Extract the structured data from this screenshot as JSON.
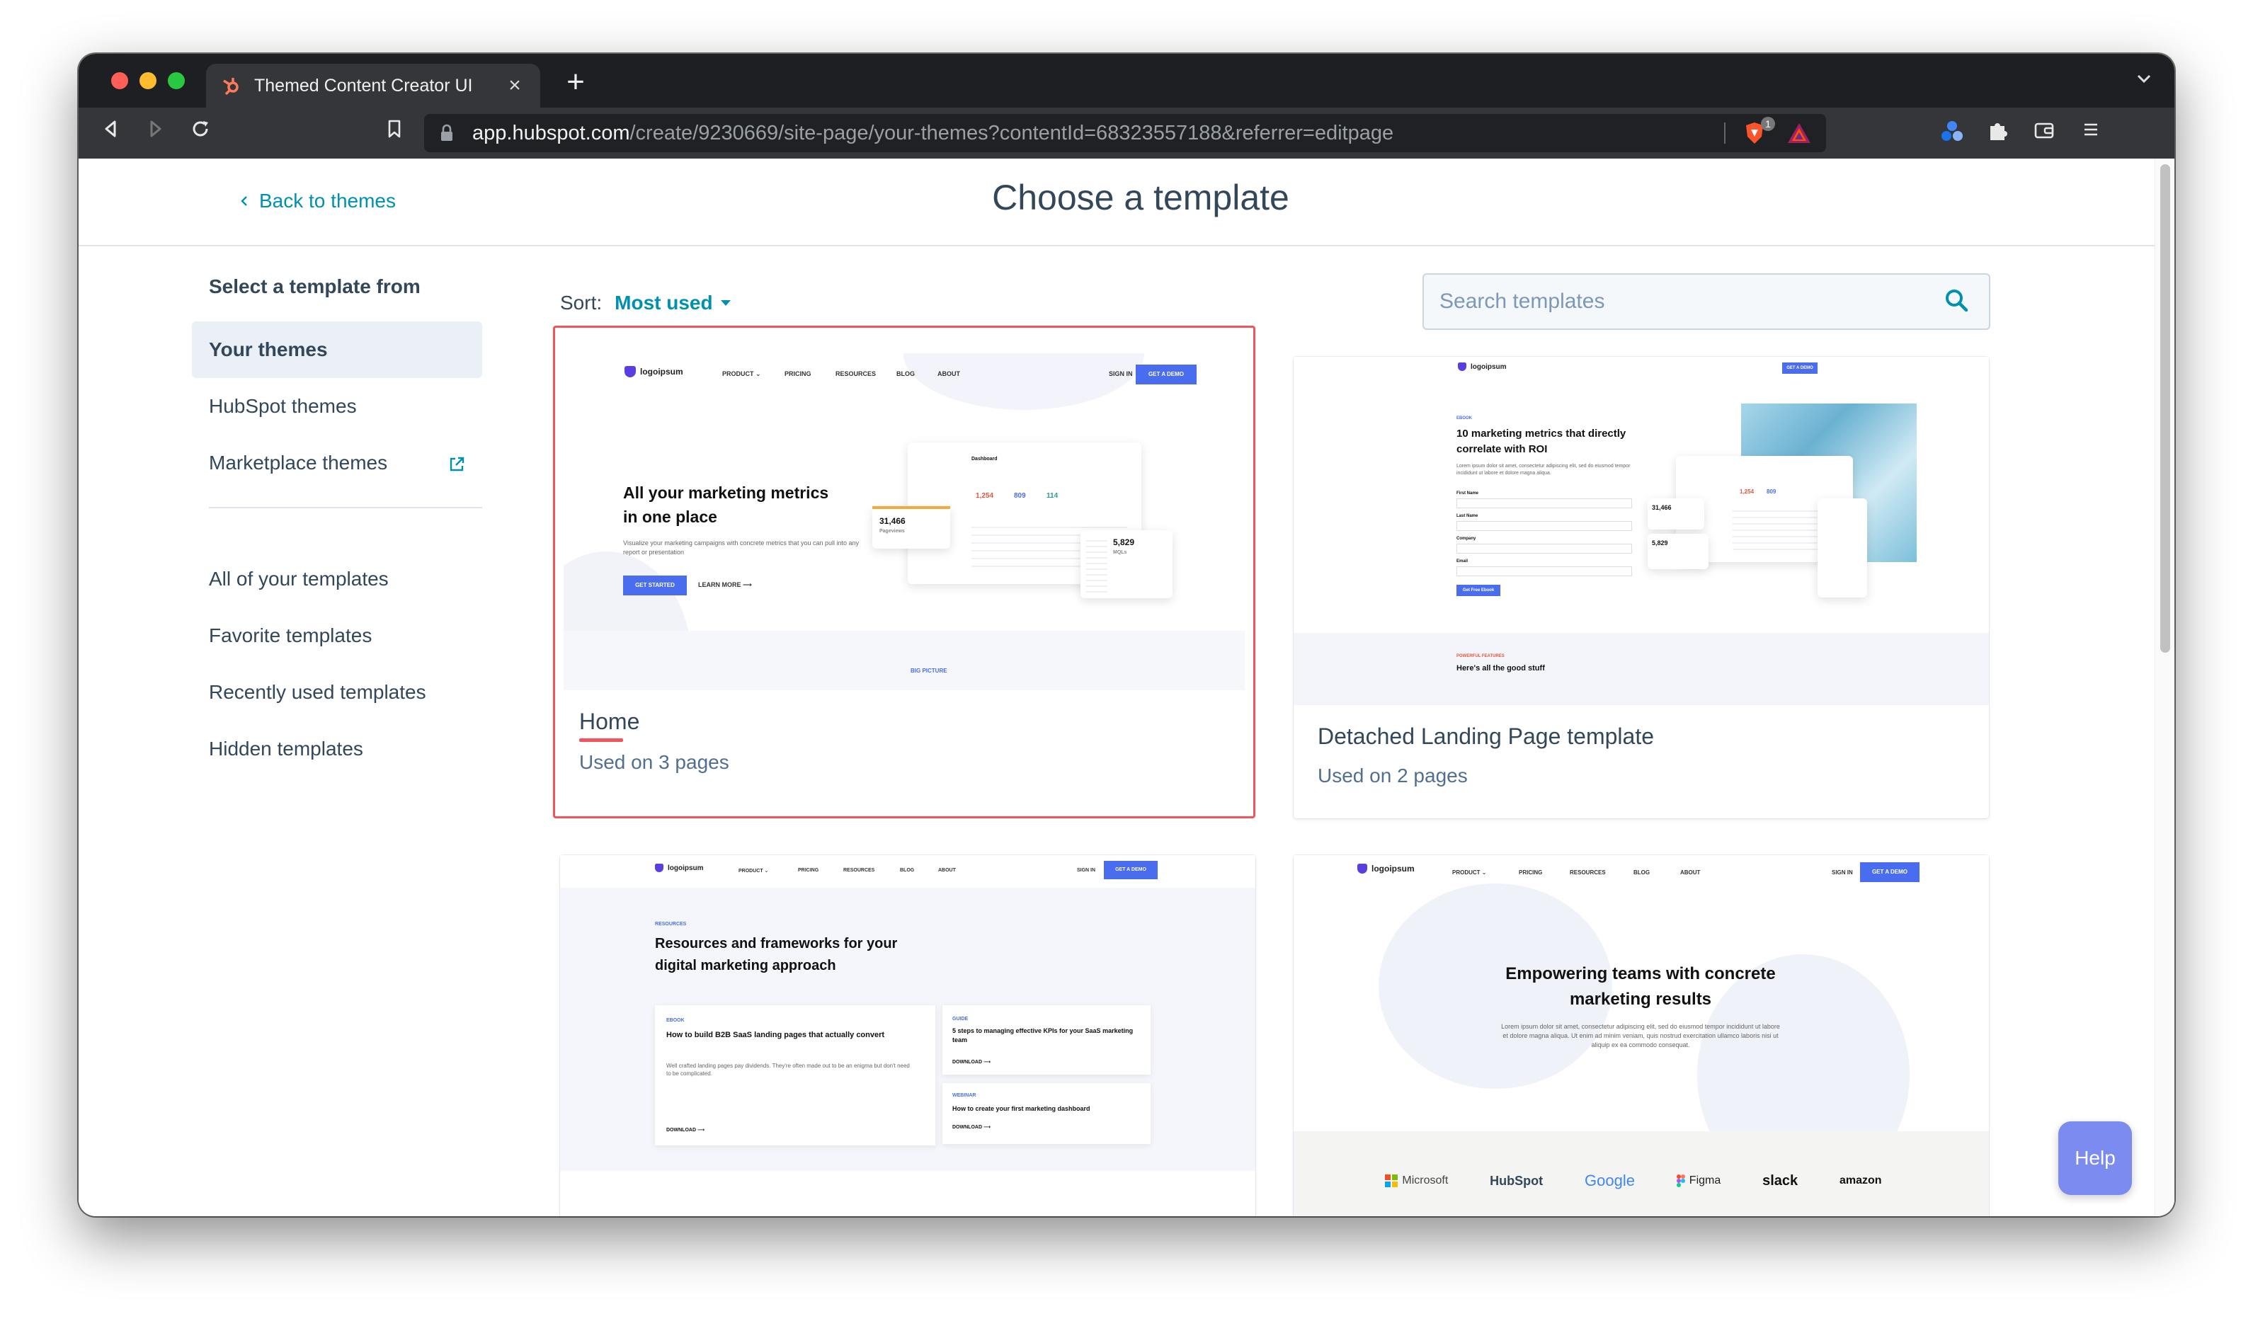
{
  "browser": {
    "tab_title": "Themed Content Creator UI",
    "tab_close": "×",
    "new_tab": "+",
    "url_host": "app.hubspot.com",
    "url_path": "/create/9230669/site-page/your-themes?contentId=68323557188&referrer=editpage",
    "shield_badge": "1"
  },
  "header": {
    "back_label": "Back to themes",
    "title": "Choose a template"
  },
  "sidebar": {
    "heading": "Select a template from",
    "sources": [
      {
        "label": "Your themes",
        "active": true
      },
      {
        "label": "HubSpot themes"
      },
      {
        "label": "Marketplace themes",
        "icon": "external-link-icon"
      }
    ],
    "filters": [
      {
        "label": "All of your templates"
      },
      {
        "label": "Favorite templates"
      },
      {
        "label": "Recently used templates"
      },
      {
        "label": "Hidden templates"
      }
    ]
  },
  "toolbar": {
    "sort_label": "Sort:",
    "sort_value": "Most used",
    "search_placeholder": "Search templates"
  },
  "templates": [
    {
      "name": "Home",
      "usage": "Used on 3 pages",
      "selected": true,
      "preview": {
        "logo": "logoipsum",
        "nav": [
          "PRODUCT ⌄",
          "PRICING",
          "RESOURCES",
          "BLOG",
          "ABOUT"
        ],
        "signin": "SIGN IN",
        "cta": "GET A DEMO",
        "headline": "All your marketing metrics in one place",
        "body": "Visualize your marketing campaigns with concrete metrics that you can pull into any report or presentation",
        "btn": "GET STARTED",
        "link": "LEARN MORE ⟶",
        "footer": "BIG PICTURE",
        "dash_title": "Dashboard",
        "stat1": "31,466",
        "stat1_label": "Pageviews",
        "stat2": "5,829",
        "stat2_label": "MQLs",
        "nums": [
          "1,254",
          "809",
          "114"
        ]
      }
    },
    {
      "name": "Detached Landing Page template",
      "usage": "Used on 2 pages",
      "preview": {
        "eyebrow": "EBOOK",
        "headline": "10 marketing metrics that directly correlate with ROI",
        "body": "Lorem ipsum dolor sit amet, consectetur adipiscing elit, sed do eiusmod tempor incididunt ut labore et dolore magna aliqua.",
        "fields": [
          "First Name",
          "Last Name",
          "Company",
          "Email"
        ],
        "btn": "Get Free Ebook",
        "subeyebrow": "POWERFUL FEATURES",
        "subhead": "Here's all the good stuff",
        "stat1": "31,466",
        "stat2": "5,829"
      }
    },
    {
      "name": "",
      "preview": {
        "eyebrow": "RESOURCES",
        "headline": "Resources and frameworks for your digital marketing approach",
        "card1_tag": "EBOOK",
        "card1_title": "How to build B2B SaaS landing pages that actually convert",
        "card1_body": "Well crafted landing pages pay dividends. They're often made out to be an enigma but don't need to be complicated.",
        "card1_link": "DOWNLOAD ⟶",
        "card2_tag": "GUIDE",
        "card2_title": "5 steps to managing effective KPIs for your SaaS marketing team",
        "card2_link": "DOWNLOAD ⟶",
        "card3_tag": "WEBINAR",
        "card3_title": "How to create your first marketing dashboard",
        "card3_link": "DOWNLOAD ⟶"
      }
    },
    {
      "name": "",
      "preview": {
        "headline": "Empowering teams with concrete marketing results",
        "body": "Lorem ipsum dolor sit amet, consectetur adipiscing elit, sed do eiusmod tempor incididunt ut labore et dolore magna aliqua. Ut enim ad minim veniam, quis nostrud exercitation ullamco laboris nisi ut aliquip ex ea commodo consequat.",
        "brands": [
          "Microsoft",
          "HubSpot",
          "Google",
          "Figma",
          "slack",
          "amazon"
        ]
      }
    }
  ],
  "help_label": "Help",
  "colors": {
    "accent": "#0091ae",
    "selected_border": "#f2545b",
    "text": "#33475b",
    "preview_blue": "#4a6df0"
  }
}
